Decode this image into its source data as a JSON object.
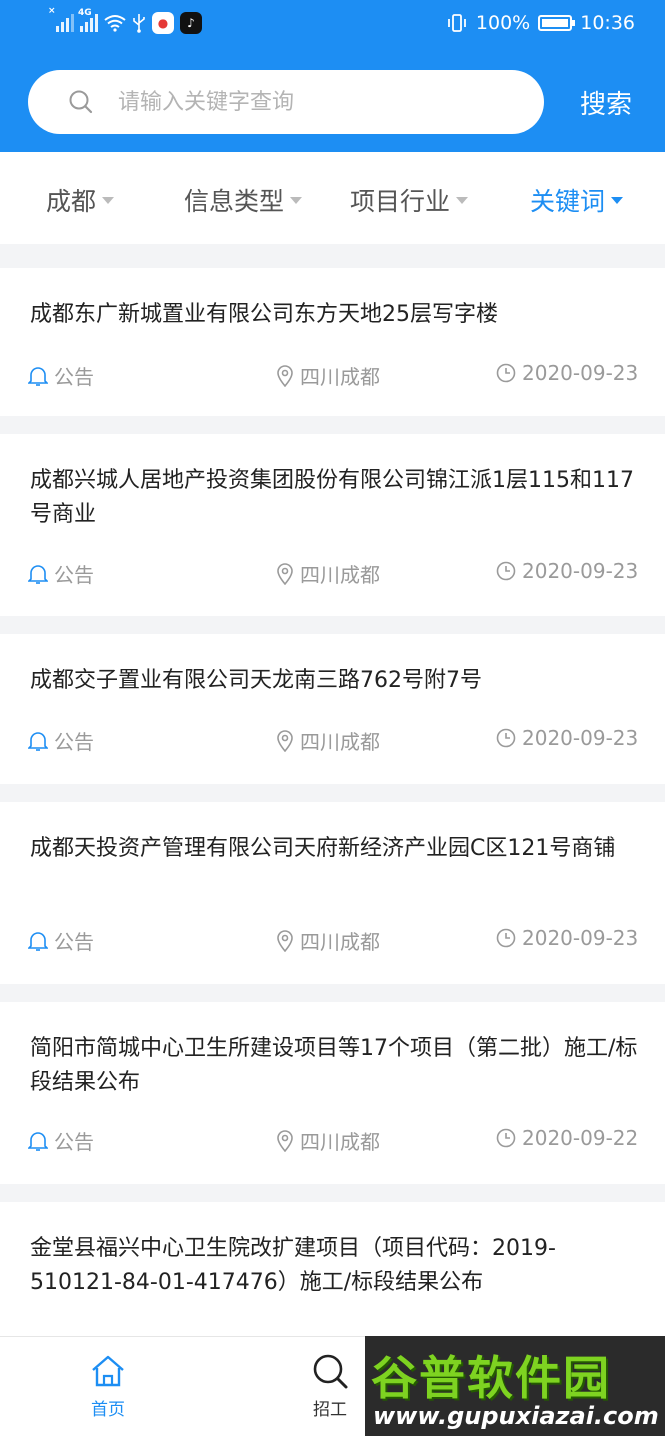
{
  "status_bar": {
    "signal_tag": "4G",
    "battery": "100%",
    "time": "10:36"
  },
  "search": {
    "placeholder": "请输入关键字查询",
    "button": "搜索"
  },
  "filters": [
    "成都",
    "信息类型",
    "项目行业",
    "关键词"
  ],
  "active_filter_index": 3,
  "items": [
    {
      "title": "成都东广新城置业有限公司东方天地25层写字楼",
      "type": "公告",
      "location": "四川成都",
      "date": "2020-09-23"
    },
    {
      "title": "成都兴城人居地产投资集团股份有限公司锦江派1层115和117号商业",
      "type": "公告",
      "location": "四川成都",
      "date": "2020-09-23"
    },
    {
      "title": "成都交子置业有限公司天龙南三路762号附7号",
      "type": "公告",
      "location": "四川成都",
      "date": "2020-09-23"
    },
    {
      "title": "成都天投资产管理有限公司天府新经济产业园C区121号商铺",
      "type": "公告",
      "location": "四川成都",
      "date": "2020-09-23"
    },
    {
      "title": "简阳市简城中心卫生所建设项目等17个项目（第二批）施工/标段结果公布",
      "type": "公告",
      "location": "四川成都",
      "date": "2020-09-22"
    },
    {
      "title": "金堂县福兴中心卫生院改扩建项目（项目代码：2019-510121-84-01-417476）施工/标段结果公布"
    }
  ],
  "tabs": [
    {
      "label": "首页",
      "icon": "home-icon",
      "active": true
    },
    {
      "label": "招工",
      "icon": "search-icon",
      "active": false
    }
  ],
  "watermark": {
    "logo": "谷普软件园",
    "url": "www.gupuxiazai.com"
  },
  "colors": {
    "primary": "#1d8ef3",
    "background": "#f3f4f6",
    "meta_text": "#9a9a9a"
  }
}
